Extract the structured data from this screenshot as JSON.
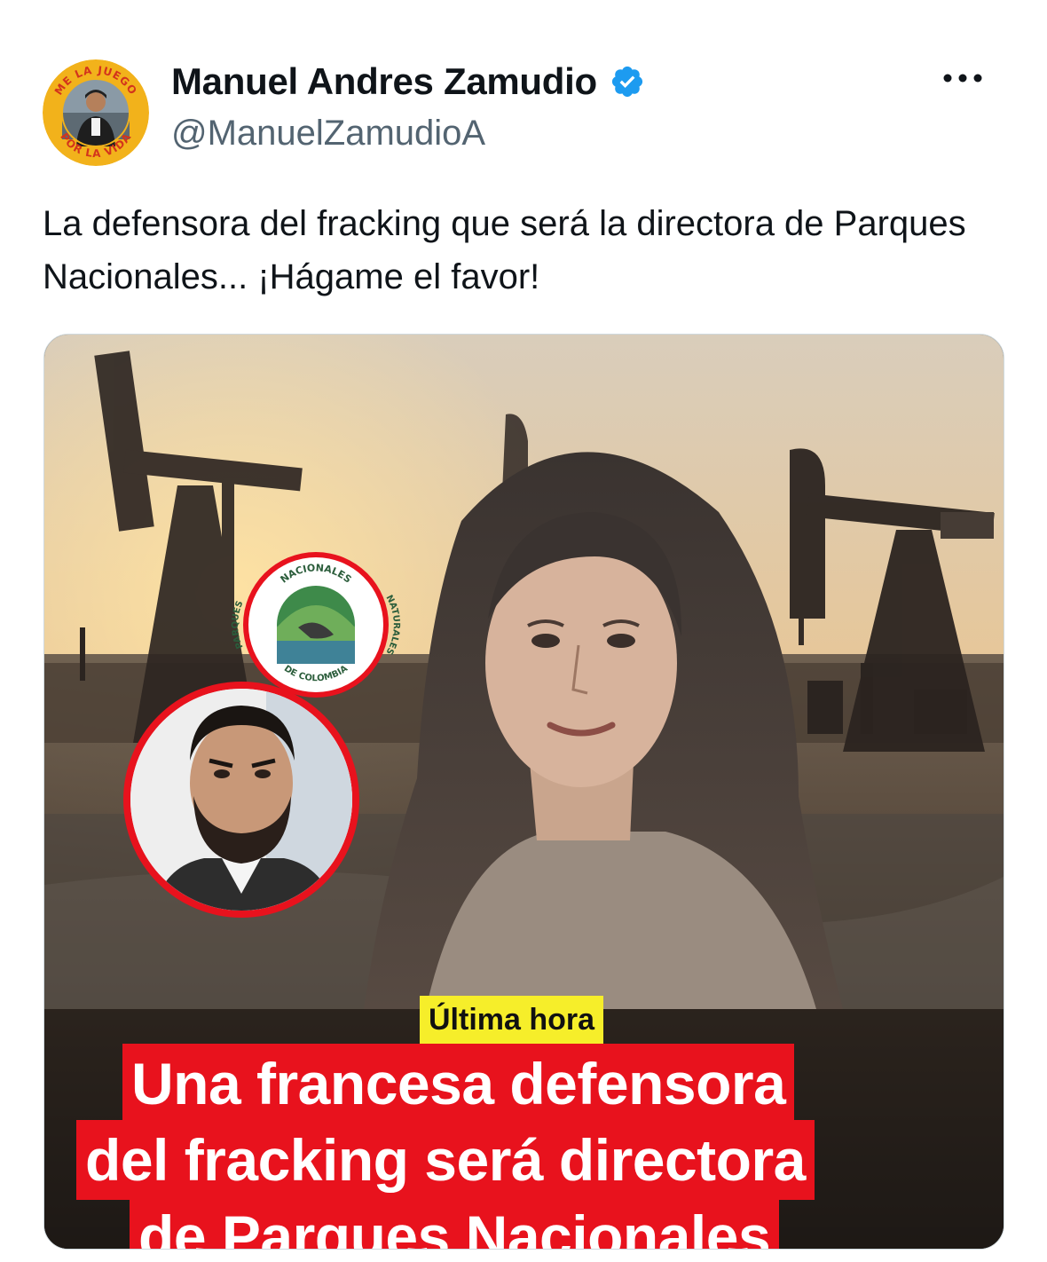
{
  "author": {
    "display_name": "Manuel Andres Zamudio",
    "handle": "@ManuelZamudioA",
    "avatar_ring_top": "ME LA JUEGO",
    "avatar_ring_bottom": "POR LA VIDA"
  },
  "tweet": {
    "text": "La defensora del fracking que será la directora de Parques Nacionales... ¡Hágame el favor!"
  },
  "media": {
    "logo_text_top": "NACIONALES",
    "logo_text_left": "PARQUES",
    "logo_text_right": "NATURALES",
    "logo_text_bottom": "DE COLOMBIA",
    "tag": "Última hora",
    "headline_lines": [
      "Una francesa defensora",
      "del fracking será directora",
      "de Parques Nacionales"
    ]
  },
  "icons": {
    "verified": "verified-badge-icon",
    "more": "more-options-icon"
  },
  "colors": {
    "verified_blue": "#1d9bf0",
    "headline_red": "#e8121d",
    "tag_yellow": "#f6ee2a",
    "avatar_ring": "#f2b21b"
  }
}
